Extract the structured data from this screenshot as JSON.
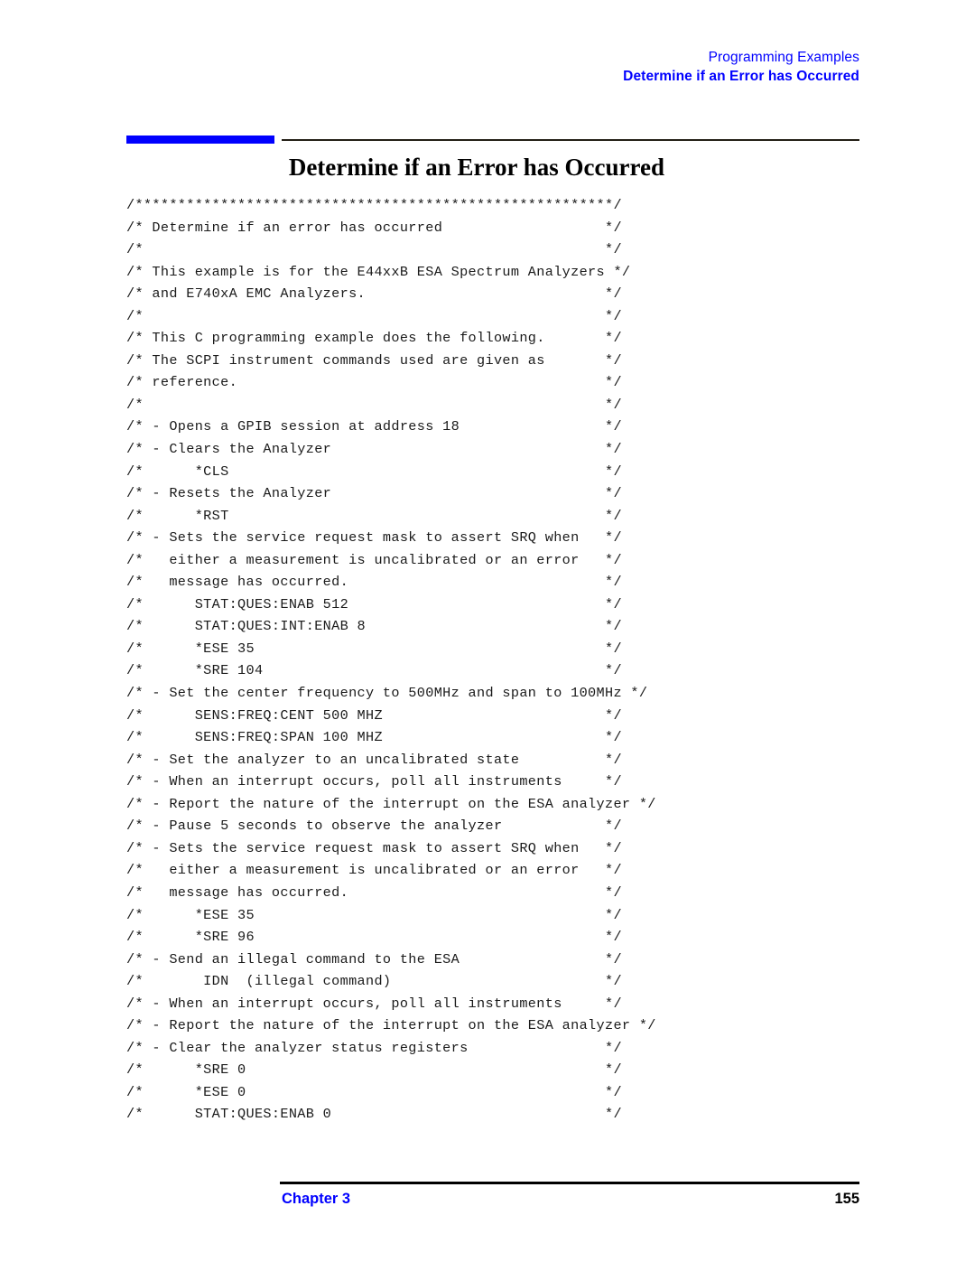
{
  "header": {
    "section": "Programming Examples",
    "topic": "Determine if an Error has Occurred"
  },
  "title": "Determine if an Error has Occurred",
  "colors": {
    "accent_blue": "#0000FF",
    "rule_black": "#000000",
    "code_text": "#1A1A1A"
  },
  "code": {
    "language": "C",
    "lines": [
      "/********************************************************/",
      "/* Determine if an error has occurred                   */",
      "/*                                                      */",
      "/* This example is for the E44xxB ESA Spectrum Analyzers */",
      "/* and E740xA EMC Analyzers.                            */",
      "/*                                                      */",
      "/* This C programming example does the following.       */",
      "/* The SCPI instrument commands used are given as       */",
      "/* reference.                                           */",
      "/*                                                      */",
      "/* - Opens a GPIB session at address 18                 */",
      "/* - Clears the Analyzer                                */",
      "/*      *CLS                                            */",
      "/* - Resets the Analyzer                                */",
      "/*      *RST                                            */",
      "/* - Sets the service request mask to assert SRQ when   */",
      "/*   either a measurement is uncalibrated or an error   */",
      "/*   message has occurred.                              */",
      "/*      STAT:QUES:ENAB 512                              */",
      "/*      STAT:QUES:INT:ENAB 8                            */",
      "/*      *ESE 35                                         */",
      "/*      *SRE 104                                        */",
      "/* - Set the center frequency to 500MHz and span to 100MHz */",
      "/*      SENS:FREQ:CENT 500 MHZ                          */",
      "/*      SENS:FREQ:SPAN 100 MHZ                          */",
      "/* - Set the analyzer to an uncalibrated state          */",
      "/* - When an interrupt occurs, poll all instruments     */",
      "/* - Report the nature of the interrupt on the ESA analyzer */",
      "/* - Pause 5 seconds to observe the analyzer            */",
      "/* - Sets the service request mask to assert SRQ when   */",
      "/*   either a measurement is uncalibrated or an error   */",
      "/*   message has occurred.                              */",
      "/*      *ESE 35                                         */",
      "/*      *SRE 96                                         */",
      "/* - Send an illegal command to the ESA                 */",
      "/*       IDN  (illegal command)                         */",
      "/* - When an interrupt occurs, poll all instruments     */",
      "/* - Report the nature of the interrupt on the ESA analyzer */",
      "/* - Clear the analyzer status registers                */",
      "/*      *SRE 0                                          */",
      "/*      *ESE 0                                          */",
      "/*      STAT:QUES:ENAB 0                                */"
    ]
  },
  "footer": {
    "chapter": "Chapter 3",
    "page_number": "155"
  }
}
